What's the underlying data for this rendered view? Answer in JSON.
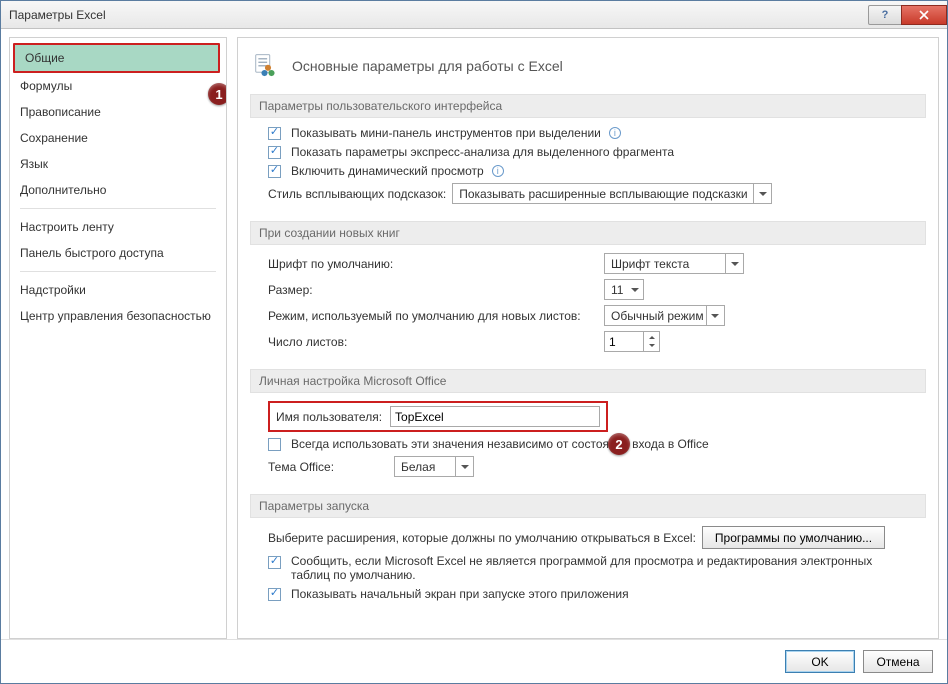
{
  "title": "Параметры Excel",
  "sidebar": {
    "groups": [
      [
        "Общие",
        "Формулы",
        "Правописание",
        "Сохранение",
        "Язык",
        "Дополнительно"
      ],
      [
        "Настроить ленту",
        "Панель быстрого доступа"
      ],
      [
        "Надстройки",
        "Центр управления безопасностью"
      ]
    ],
    "selected": "Общие"
  },
  "badges": {
    "one": "1",
    "two": "2"
  },
  "main": {
    "heading": "Основные параметры для работы с Excel",
    "sections": {
      "ui": {
        "title": "Параметры пользовательского интерфейса",
        "chk1": "Показывать мини-панель инструментов при выделении",
        "chk2": "Показать параметры экспресс-анализа для выделенного фрагмента",
        "chk3": "Включить динамический просмотр",
        "tooltip_label": "Стиль всплывающих подсказок:",
        "tooltip_value": "Показывать расширенные всплывающие подсказки"
      },
      "newbook": {
        "title": "При создании новых книг",
        "font_label": "Шрифт по умолчанию:",
        "font_value": "Шрифт текста",
        "size_label": "Размер:",
        "size_value": "11",
        "mode_label": "Режим, используемый по умолчанию для новых листов:",
        "mode_value": "Обычный режим",
        "sheets_label": "Число листов:",
        "sheets_value": "1"
      },
      "personal": {
        "title": "Личная настройка Microsoft Office",
        "user_label": "Имя пользователя:",
        "user_value": "TopExcel",
        "always": "Всегда использовать эти значения независимо от состояния входа в Office",
        "theme_label": "Тема Office:",
        "theme_value": "Белая"
      },
      "startup": {
        "title": "Параметры запуска",
        "ext_label": "Выберите расширения, которые должны по умолчанию открываться в Excel:",
        "ext_button": "Программы по умолчанию...",
        "notify": "Сообщить, если Microsoft Excel не является программой для просмотра и редактирования электронных таблиц по умолчанию.",
        "startscreen": "Показывать начальный экран при запуске этого приложения"
      }
    }
  },
  "footer": {
    "ok": "OK",
    "cancel": "Отмена"
  }
}
